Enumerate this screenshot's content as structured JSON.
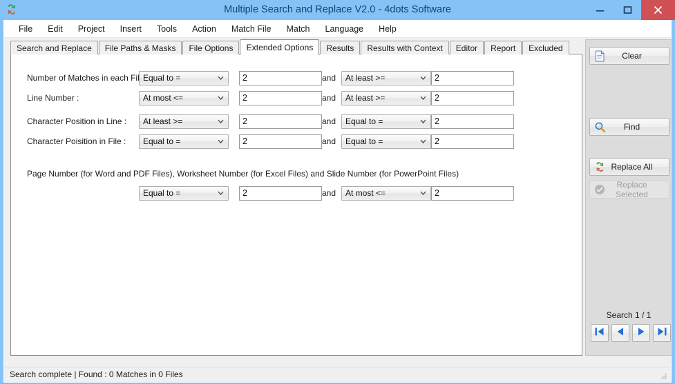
{
  "window": {
    "title": "Multiple Search and Replace V2.0 - 4dots Software",
    "app_icon": "app-logo-icon",
    "controls": {
      "minimize": "minimize-icon",
      "maximize": "maximize-icon",
      "close": "close-icon"
    },
    "colors": {
      "titlebar": "#85c3f7",
      "title_text": "#14436e",
      "close_button": "#cf5153",
      "panel_bg": "#dcdcdc",
      "accent_blue": "#1e6fd9"
    }
  },
  "menubar": {
    "items": [
      {
        "label": "File"
      },
      {
        "label": "Edit"
      },
      {
        "label": "Project"
      },
      {
        "label": "Insert"
      },
      {
        "label": "Tools"
      },
      {
        "label": "Action"
      },
      {
        "label": "Match File"
      },
      {
        "label": "Match"
      },
      {
        "label": "Language"
      },
      {
        "label": "Help"
      }
    ]
  },
  "tabs": {
    "active_index": 3,
    "items": [
      {
        "label": "Search and Replace"
      },
      {
        "label": "File Paths & Masks"
      },
      {
        "label": "File Options"
      },
      {
        "label": "Extended Options"
      },
      {
        "label": "Results"
      },
      {
        "label": "Results with Context"
      },
      {
        "label": "Editor"
      },
      {
        "label": "Report"
      },
      {
        "label": "Excluded"
      }
    ]
  },
  "extended_options": {
    "and_label": "and",
    "rows": [
      {
        "label": "Number of Matches in each File :",
        "op1": "Equal to =",
        "val1": "2",
        "op2": "At least >=",
        "val2": "2"
      },
      {
        "label": "Line Number :",
        "op1": "At most <=",
        "val1": "2",
        "op2": "At least >=",
        "val2": "2"
      },
      {
        "label": "Character Position in Line :",
        "op1": "At least >=",
        "val1": "2",
        "op2": "Equal to =",
        "val2": "2"
      },
      {
        "label": "Character Poisition in File :",
        "op1": "Equal to =",
        "val1": "2",
        "op2": "Equal to =",
        "val2": "2"
      }
    ],
    "page_section": {
      "note": "Page Number (for Word and PDF Files), Worksheet Number (for Excel Files) and Slide Number (for PowerPoint Files)",
      "op1": "Equal to =",
      "val1": "2",
      "op2": "At most <=",
      "val2": "2"
    },
    "operator_options": [
      "Equal to =",
      "At least >=",
      "At most <="
    ]
  },
  "sidepanel": {
    "buttons": [
      {
        "label": "Clear",
        "icon": "document-page-icon",
        "enabled": true
      },
      {
        "label": "Find",
        "icon": "magnifier-icon",
        "enabled": true
      },
      {
        "label": "Replace All",
        "icon": "replace-arrows-icon",
        "enabled": true
      },
      {
        "label": "Replace Selected",
        "icon": "check-circle-icon",
        "enabled": false
      }
    ],
    "search_counter": "Search 1 / 1",
    "nav_buttons": [
      {
        "name": "first",
        "icon": "skip-to-first-icon"
      },
      {
        "name": "previous",
        "icon": "arrow-left-icon"
      },
      {
        "name": "next",
        "icon": "arrow-right-icon"
      },
      {
        "name": "last",
        "icon": "skip-to-last-icon"
      }
    ]
  },
  "statusbar": {
    "text": "Search complete | Found : 0 Matches in 0 Files",
    "grip": "resize-grip-icon"
  }
}
